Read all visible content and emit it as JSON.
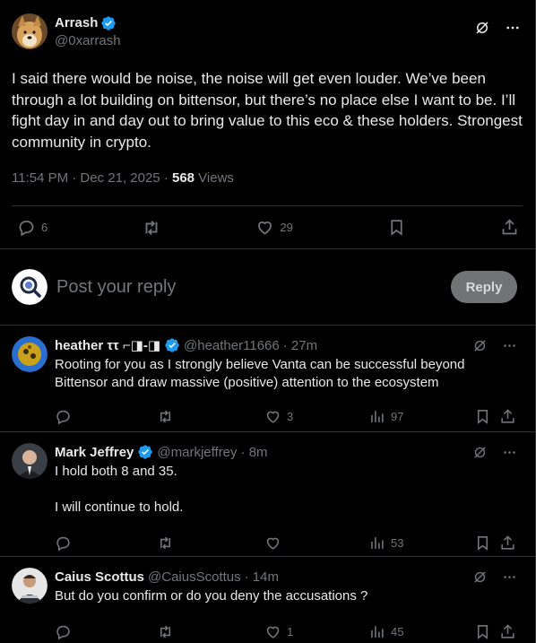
{
  "main_post": {
    "author_name": "Arrash",
    "author_handle": "@0xarrash",
    "text": "I said there would be noise, the noise will get even louder. We’ve been through a lot building on bittensor, but there’s no place else I want to be. I’ll fight day in and day out to bring value to this eco & these holders. Strongest community in crypto.",
    "time": "11:54 PM · Dec 21, 2025 · ",
    "views_count": "568",
    "views_label": " Views",
    "replies": "6",
    "likes": "29"
  },
  "reply_box": {
    "placeholder": "Post your reply",
    "button": "Reply"
  },
  "replies": [
    {
      "name": "heather ττ ⌐◨-◨",
      "handle": "@heather11666",
      "time": "· 27m",
      "text": "Rooting for you as I strongly believe Vanta can be successful beyond Bittensor and draw massive (positive) attention to the ecosystem",
      "likes": "3",
      "views": "97"
    },
    {
      "name": "Mark Jeffrey",
      "handle": "@markjeffrey",
      "time": "· 8m",
      "text": "I hold both 8 and 35.\n\nI will continue to hold.",
      "likes": "",
      "views": "53"
    },
    {
      "name": "Caius Scottus",
      "handle": "@CaiusScottus",
      "time": "· 14m",
      "text": "But do you confirm or do you deny the accusations ?",
      "likes": "1",
      "views": "45"
    }
  ],
  "colors": {
    "background": "#000000",
    "text": "#e7e9ea",
    "muted": "#71767b",
    "verified": "#1d9bf0",
    "border": "#2f3336"
  }
}
